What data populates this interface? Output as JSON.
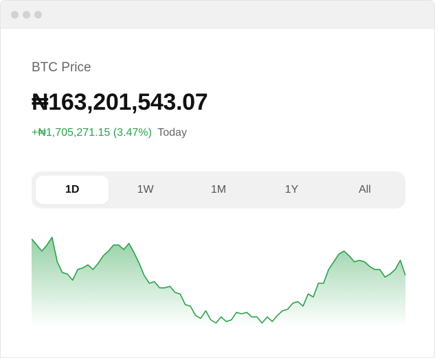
{
  "window": {
    "controls": [
      "close",
      "minimize",
      "maximize"
    ]
  },
  "asset": {
    "label": "BTC Price"
  },
  "price": {
    "value": "₦163,201,543.07"
  },
  "change": {
    "amount": "+₦1,705,271.15 (3.47%)",
    "period": "Today"
  },
  "range_tabs": [
    {
      "label": "1D",
      "active": true
    },
    {
      "label": "1W",
      "active": false
    },
    {
      "label": "1M",
      "active": false
    },
    {
      "label": "1Y",
      "active": false
    },
    {
      "label": "All",
      "active": false
    }
  ],
  "colors": {
    "positive": "#2aa14a",
    "line": "#2aa14a"
  },
  "chart_data": {
    "type": "area",
    "period": "1D",
    "values": [
      78,
      74,
      70,
      74,
      79,
      63,
      56,
      55,
      51,
      58,
      59,
      61,
      58,
      62,
      67,
      70,
      74,
      74,
      71,
      75,
      69,
      62,
      54,
      49,
      50,
      46,
      46,
      47,
      43,
      42,
      35,
      34,
      28,
      26,
      31,
      25,
      23,
      27,
      24,
      25,
      30,
      29,
      30,
      27,
      27,
      23,
      27,
      24,
      28,
      31,
      32,
      36,
      37,
      34,
      42,
      40,
      49,
      49,
      58,
      63,
      68,
      70,
      67,
      63,
      64,
      63,
      60,
      58,
      58,
      53,
      55,
      58,
      64,
      54
    ]
  }
}
